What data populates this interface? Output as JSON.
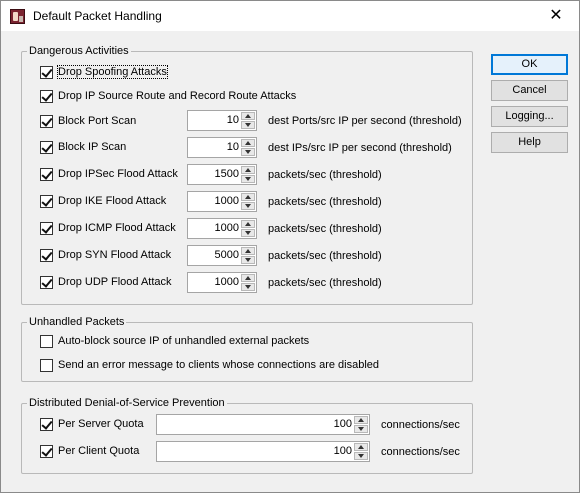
{
  "window": {
    "title": "Default Packet Handling",
    "close_glyph": "✕"
  },
  "dangerous": {
    "legend": "Dangerous Activities",
    "items": [
      {
        "label": "Drop Spoofing Attacks",
        "checked": true
      },
      {
        "label": "Drop IP Source Route and Record Route Attacks",
        "checked": true
      },
      {
        "label": "Block Port Scan",
        "checked": true,
        "value": "10",
        "unit": "dest Ports/src IP per second (threshold)"
      },
      {
        "label": "Block IP Scan",
        "checked": true,
        "value": "10",
        "unit": "dest IPs/src IP per second (threshold)"
      },
      {
        "label": "Drop IPSec Flood Attack",
        "checked": true,
        "value": "1500",
        "unit": "packets/sec (threshold)"
      },
      {
        "label": "Drop IKE Flood Attack",
        "checked": true,
        "value": "1000",
        "unit": "packets/sec (threshold)"
      },
      {
        "label": "Drop ICMP Flood Attack",
        "checked": true,
        "value": "1000",
        "unit": "packets/sec (threshold)"
      },
      {
        "label": "Drop SYN Flood Attack",
        "checked": true,
        "value": "5000",
        "unit": "packets/sec (threshold)"
      },
      {
        "label": "Drop UDP Flood Attack",
        "checked": true,
        "value": "1000",
        "unit": "packets/sec (threshold)"
      }
    ]
  },
  "unhandled": {
    "legend": "Unhandled Packets",
    "items": [
      {
        "label": "Auto-block source IP of unhandled external packets",
        "checked": false
      },
      {
        "label": "Send an error message to clients whose connections are disabled",
        "checked": false
      }
    ]
  },
  "ddos": {
    "legend": "Distributed Denial-of-Service Prevention",
    "items": [
      {
        "label": "Per Server Quota",
        "checked": true,
        "value": "100",
        "unit": "connections/sec"
      },
      {
        "label": "Per Client Quota",
        "checked": true,
        "value": "100",
        "unit": "connections/sec"
      }
    ]
  },
  "buttons": {
    "ok": "OK",
    "cancel": "Cancel",
    "logging": "Logging...",
    "help": "Help"
  }
}
